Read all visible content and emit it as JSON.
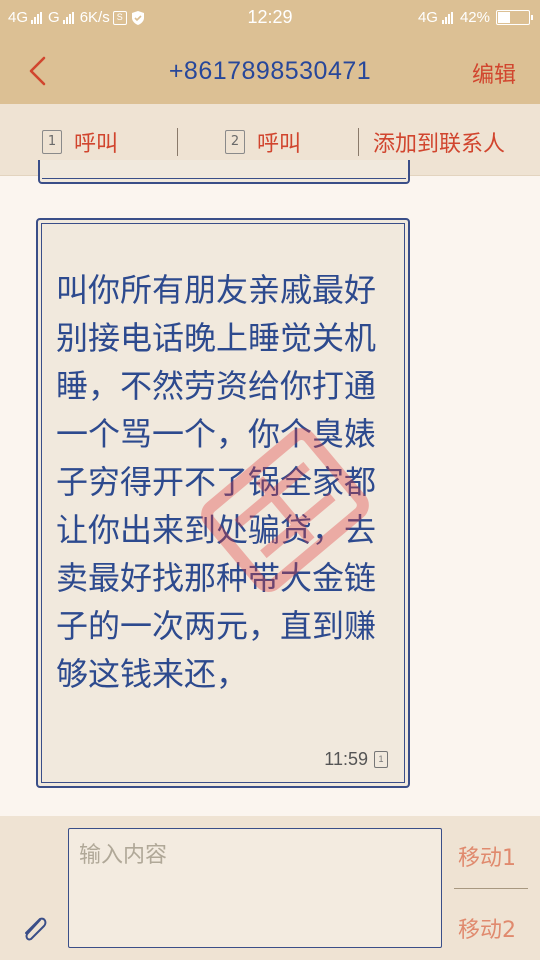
{
  "status_bar": {
    "net1": "4G",
    "net2": "G",
    "speed": "6K/s",
    "time": "12:29",
    "net3": "4G",
    "battery": "42%",
    "battery_level": 0.42
  },
  "header": {
    "title": "+8617898530471",
    "edit_label": "编辑"
  },
  "actions": {
    "call1_sim": "1",
    "call1_label": "呼叫",
    "call2_sim": "2",
    "call2_label": "呼叫",
    "add_contact_label": "添加到联系人"
  },
  "message": {
    "text": "叫你所有朋友亲戚最好别接电话晚上睡觉关机睡，不然劳资给你打通一个骂一个，你个臭婊子穷得开不了锅全家都让你出来到处骗贷，去卖最好找那种带大金链子的一次两元，直到赚够这钱来还，",
    "time": "11:59",
    "sim": "1"
  },
  "composer": {
    "placeholder": "输入内容",
    "move1_label": "移动1",
    "move2_label": "移动2"
  },
  "colors": {
    "header_bg": "#dcc094",
    "accent_red": "#d1452e",
    "ink_blue": "#2d4a8e"
  }
}
